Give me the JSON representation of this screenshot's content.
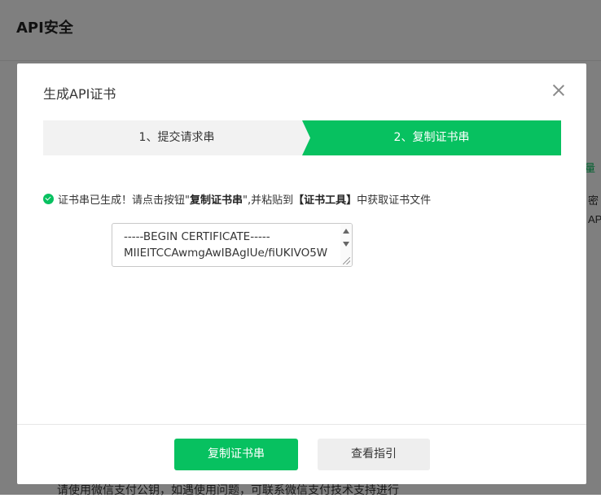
{
  "background": {
    "page_title": "API安全",
    "right_edge_texts": [
      "量",
      "密",
      "AP"
    ],
    "bottom_text": "请使用微信支付公钥，如遇使用问题，可联系微信支付技术支持进行"
  },
  "modal": {
    "title": "生成API证书",
    "steps": [
      {
        "label": "1、提交请求串",
        "active": false
      },
      {
        "label": "2、复制证书串",
        "active": true
      }
    ],
    "message": {
      "part1": "证书串已生成！请点击按钮\"",
      "bold1": "复制证书串",
      "part2": "\",并粘贴到",
      "bold2": "【证书工具】",
      "part3": "中获取证书文件"
    },
    "certificate_text": "-----BEGIN CERTIFICATE-----\nMIIEITCCAwmgAwIBAgIUe/fiUKIVO5W",
    "buttons": {
      "copy": "复制证书串",
      "guide": "查看指引"
    }
  },
  "colors": {
    "accent": "#07c160",
    "overlay": "rgba(0,0,0,0.5)"
  }
}
